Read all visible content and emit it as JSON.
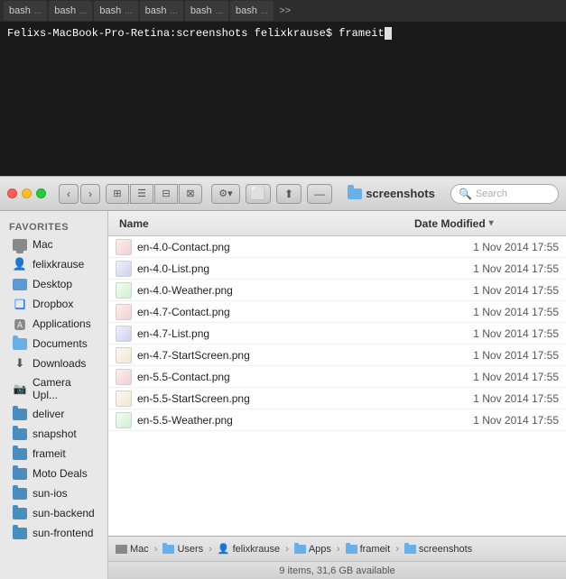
{
  "terminal": {
    "tabs": [
      {
        "label": "bash",
        "dots": "..."
      },
      {
        "label": "bash",
        "dots": "..."
      },
      {
        "label": "bash",
        "dots": "..."
      },
      {
        "label": "bash",
        "dots": "..."
      },
      {
        "label": "bash",
        "dots": "..."
      },
      {
        "label": "bash",
        "dots": "..."
      }
    ],
    "more_label": ">>",
    "prompt": "Felixs-MacBook-Pro-Retina:screenshots felixkrause$ frameit"
  },
  "finder": {
    "title": "screenshots",
    "toolbar": {
      "back_label": "‹",
      "forward_label": "›",
      "view_icon_label": "⊞",
      "view_list_label": "☰",
      "view_col_label": "⊟",
      "view_cov_label": "⊠",
      "action_label": "⚙ ▾",
      "search_placeholder": "Search"
    },
    "columns": {
      "name_label": "Name",
      "date_label": "Date Modified",
      "sort_arrow": "▾"
    },
    "files": [
      {
        "name": "en-4.0-Contact.png",
        "date": "1 Nov 2014 17:55"
      },
      {
        "name": "en-4.0-List.png",
        "date": "1 Nov 2014 17:55"
      },
      {
        "name": "en-4.0-Weather.png",
        "date": "1 Nov 2014 17:55"
      },
      {
        "name": "en-4.7-Contact.png",
        "date": "1 Nov 2014 17:55"
      },
      {
        "name": "en-4.7-List.png",
        "date": "1 Nov 2014 17:55"
      },
      {
        "name": "en-4.7-StartScreen.png",
        "date": "1 Nov 2014 17:55"
      },
      {
        "name": "en-5.5-Contact.png",
        "date": "1 Nov 2014 17:55"
      },
      {
        "name": "en-5.5-StartScreen.png",
        "date": "1 Nov 2014 17:55"
      },
      {
        "name": "en-5.5-Weather.png",
        "date": "1 Nov 2014 17:55"
      }
    ],
    "sidebar": {
      "section_label": "Favorites",
      "items": [
        {
          "label": "Mac",
          "icon": "mac"
        },
        {
          "label": "felixkrause",
          "icon": "person"
        },
        {
          "label": "Desktop",
          "icon": "desktop"
        },
        {
          "label": "Dropbox",
          "icon": "dropbox"
        },
        {
          "label": "Applications",
          "icon": "apps"
        },
        {
          "label": "Documents",
          "icon": "folder"
        },
        {
          "label": "Downloads",
          "icon": "download"
        },
        {
          "label": "Camera Upl...",
          "icon": "camera"
        },
        {
          "label": "deliver",
          "icon": "folder"
        },
        {
          "label": "snapshot",
          "icon": "folder"
        },
        {
          "label": "frameit",
          "icon": "folder"
        },
        {
          "label": "Moto Deals",
          "icon": "folder"
        },
        {
          "label": "sun-ios",
          "icon": "folder"
        },
        {
          "label": "sun-backend",
          "icon": "folder"
        },
        {
          "label": "sun-frontend",
          "icon": "folder"
        }
      ]
    },
    "path": {
      "items": [
        {
          "label": "Mac",
          "icon": "mac"
        },
        {
          "label": "Users",
          "icon": "folder"
        },
        {
          "label": "felixkrause",
          "icon": "person"
        },
        {
          "label": "Apps",
          "icon": "folder"
        },
        {
          "label": "frameit",
          "icon": "folder"
        },
        {
          "label": "screenshots",
          "icon": "folder"
        }
      ]
    },
    "status": "9 items, 31,6 GB available"
  }
}
